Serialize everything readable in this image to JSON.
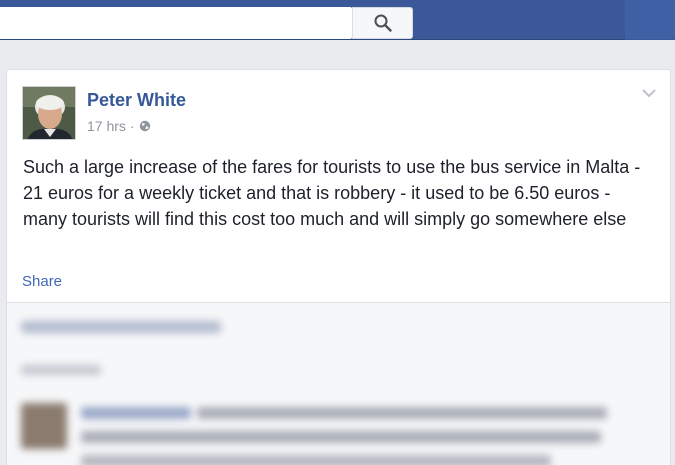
{
  "search": {
    "value": "",
    "placeholder": ""
  },
  "post": {
    "author": "Peter White",
    "time": "17 hrs",
    "separator": "·",
    "text": "Such a large increase of the fares for tourists to use the bus service in Malta - 21 euros for a weekly ticket and that is robbery - it used to be 6.50 euros - many tourists will find this cost too much and will simply go somewhere else",
    "share_label": "Share"
  },
  "colors": {
    "topbar": "#3b5998",
    "author_link": "#365899",
    "share_link": "#4267b2",
    "meta_text": "#90949c",
    "body_text": "#1d2129"
  },
  "icons": {
    "search": "search-icon",
    "audience": "globe-icon",
    "menu": "chevron-down-icon"
  }
}
